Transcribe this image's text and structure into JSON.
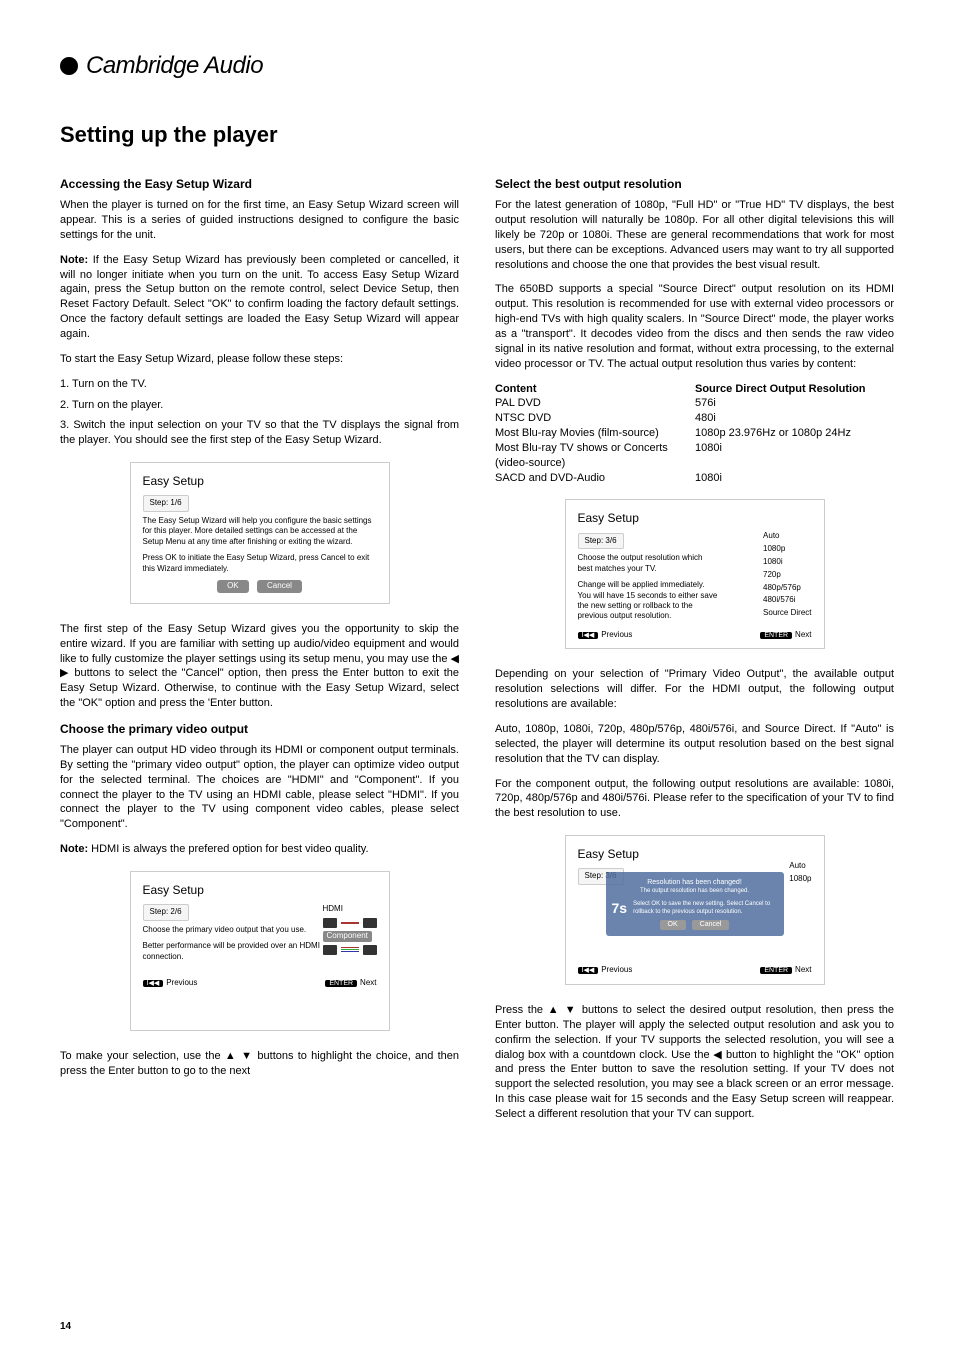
{
  "brand": "Cambridge Audio",
  "page_title": "Setting up the player",
  "page_number": "14",
  "left": {
    "s1_head": "Accessing the Easy Setup Wizard",
    "s1_p1": "When the player is turned on for the first time, an Easy Setup Wizard screen will appear. This is a series of guided instructions designed to configure the basic settings for the unit.",
    "s1_note_label": "Note:",
    "s1_note": "If the Easy Setup Wizard has previously been completed or cancelled, it will no longer initiate when you turn on the unit. To access Easy Setup Wizard again, press the Setup button on the remote control, select Device Setup, then Reset Factory Default. Select \"OK\" to confirm loading the factory default settings. Once the factory default settings are loaded the Easy Setup Wizard will appear again.",
    "s1_p2": "To start the Easy Setup Wizard, please follow these steps:",
    "steps": {
      "a": "1. Turn on the TV.",
      "b": "2. Turn on the player.",
      "c": "3. Switch the input selection on your TV so that the TV displays the signal from the player. You should see the first step of the Easy Setup Wizard."
    },
    "dlg1": {
      "title": "Easy Setup",
      "step": "Step: 1/6",
      "body1": "The Easy Setup Wizard will help you configure the basic settings for this player. More detailed settings can be accessed at the Setup Menu at any time after finishing or exiting the wizard.",
      "body2": "Press OK to initiate the Easy Setup Wizard, press Cancel to exit this Wizard immediately.",
      "ok": "OK",
      "cancel": "Cancel"
    },
    "s1_p3": "The first step of the Easy Setup Wizard gives you the opportunity to skip the entire wizard. If you are familiar with setting up audio/video equipment and would like to fully customize the player settings using its setup menu, you may use the  ◀  ▶  buttons to select the \"Cancel\" option, then press the Enter button to exit the Easy Setup Wizard. Otherwise, to continue with the Easy Setup Wizard, select the \"OK\" option and press the 'Enter button.",
    "s2_head": "Choose the primary video output",
    "s2_p1": "The player can output HD video through its HDMI or component output terminals. By setting the \"primary video output\" option, the player can optimize video output for the selected terminal. The choices are \"HDMI\" and \"Component\". If you connect the player to the TV using an HDMI cable, please select \"HDMI\". If you connect the player to the TV using component video cables, please select \"Component\".",
    "s2_note_label": "Note:",
    "s2_note": "HDMI is always the prefered option for best video quality.",
    "dlg2": {
      "title": "Easy Setup",
      "step": "Step: 2/6",
      "l1": "Choose the primary video output that you use.",
      "l2": "Better performance will be provided over an HDMI connection.",
      "hdmi": "HDMI",
      "comp": "Component",
      "prev": "Previous",
      "enter": "ENTER",
      "next": "Next"
    },
    "s2_p2": "To make your selection, use the  ▲  ▼  buttons to highlight the choice, and then press the Enter button to go to the next"
  },
  "right": {
    "s3_head": "Select the best output resolution",
    "s3_p1": "For the latest generation of 1080p, \"Full HD\" or \"True HD\" TV displays, the best output resolution will naturally be 1080p. For all other digital televisions this will likely be 720p or 1080i. These are general recommendations that work for most users, but there can be exceptions. Advanced users may want to try all supported resolutions and choose the one that provides the best visual result.",
    "s3_p2": "The 650BD supports a special \"Source Direct\" output resolution on its HDMI output. This resolution is recommended for use with external video processors or high-end TVs with high quality scalers. In \"Source Direct\" mode, the player works as a \"transport\". It decodes video from the discs and then sends the raw video signal in its native resolution and format, without extra processing, to the external video processor or TV. The actual output resolution thus varies by content:",
    "table": {
      "h1": "Content",
      "h2": "Source Direct Output Resolution",
      "r1l": "PAL DVD",
      "r1r": "576i",
      "r2l": "NTSC DVD",
      "r2r": "480i",
      "r3l": "Most Blu-ray Movies (film-source)",
      "r3r": "1080p 23.976Hz or 1080p 24Hz",
      "r4l": "Most Blu-ray TV shows or Concerts (video-source)",
      "r4r": "1080i",
      "r5l": "SACD and DVD-Audio",
      "r5r": "1080i"
    },
    "dlg3": {
      "title": "Easy Setup",
      "step": "Step: 3/6",
      "l1": "Choose the output resolution which best matches your TV.",
      "l2": "Change will be applied immediately. You will have 15 seconds to either save the new setting or rollback to the previous output resolution.",
      "opts": {
        "a": "Auto",
        "b": "1080p",
        "c": "1080i",
        "d": "720p",
        "e": "480p/576p",
        "f": "480i/576i",
        "g": "Source Direct"
      },
      "prev": "Previous",
      "enter": "ENTER",
      "next": "Next"
    },
    "s3_p3": "Depending on your selection of \"Primary Video Output\", the available output resolution selections will differ. For the HDMI output, the following output resolutions are available:",
    "s3_p4": "Auto, 1080p, 1080i, 720p, 480p/576p, 480i/576i, and Source Direct. If \"Auto\" is selected, the player will determine its output resolution based on the best signal resolution that the TV can display.",
    "s3_p5": "For the component output, the following output resolutions are available: 1080i, 720p, 480p/576p and 480i/576i.  Please refer to the specification of your TV to find the best resolution to use.",
    "dlg4": {
      "title": "Easy Setup",
      "step": "Step: 3/6",
      "ov_title": "Resolution has been changed!",
      "ov_sub": "The output resolution has been changed.",
      "ov_timer": "7s",
      "ov_body": "Select OK to save the new setting. Select Cancel to rollback to the previous output resolution.",
      "ok": "OK",
      "cancel": "Cancel",
      "prev": "Previous",
      "enter": "ENTER",
      "next": "Next",
      "opt_a": "Auto",
      "opt_b": "1080p"
    },
    "s3_p6": "Press the  ▲  ▼  buttons to select the desired output resolution, then press the Enter button. The player will apply the selected output resolution and ask you to confirm the selection. If your TV supports the selected resolution, you will see a dialog box with a countdown clock. Use the  ◀  button to highlight the \"OK\" option and press the Enter button to save the resolution setting. If your TV does not support the selected resolution, you may see a black screen or an error message. In this case please wait for 15 seconds and the Easy Setup screen will reappear. Select a different resolution that your TV can support."
  }
}
